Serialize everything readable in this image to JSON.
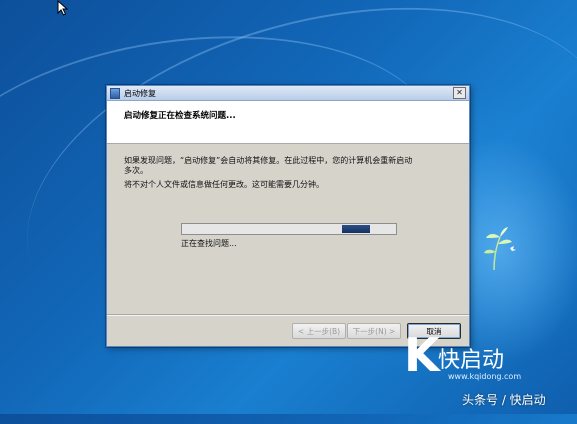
{
  "dialog": {
    "title": "启动修复",
    "close_glyph": "✕",
    "header_title": "启动修复正在检查系统问题...",
    "message_line1": "如果发现问题，“启动修复”会自动将其修复。在此过程中，您的计算机会重新启动",
    "message_line1b": "多次。",
    "message_line2": "将不对个人文件或信息做任何更改。这可能需要几分钟。",
    "status_text": "正在查找问题...",
    "buttons": {
      "back": "< 上一步(B)",
      "next": "下一步(N) >",
      "cancel": "取消"
    }
  },
  "brand": {
    "logo_letter": "K",
    "name": "快启动",
    "url": "www.kqidong.com"
  },
  "watermark": "头条号 / 快启动",
  "colors": {
    "desktop": "#1267b8",
    "dialog_bg": "#d6d3cb",
    "progress_chunk": "#2a4e88"
  },
  "icons": [
    "cursor-icon",
    "startup-repair-icon",
    "close-icon",
    "plant-icon"
  ]
}
